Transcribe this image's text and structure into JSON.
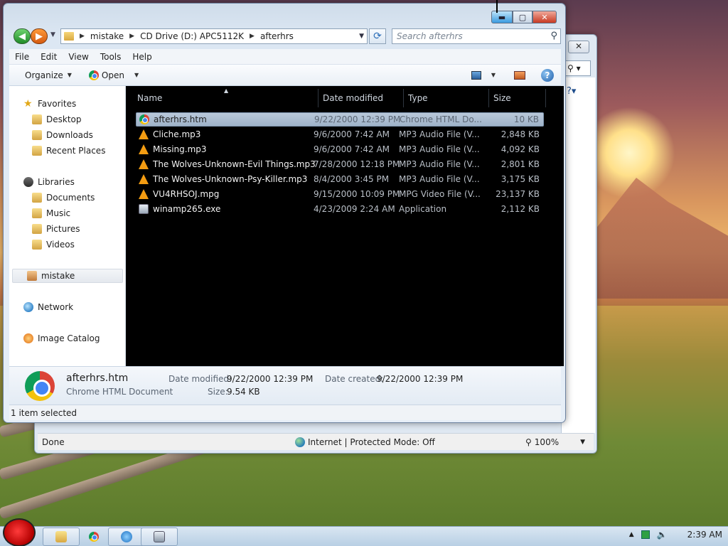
{
  "explorer": {
    "breadcrumb": [
      "mistake",
      "CD Drive (D:) APC5112K",
      "afterhrs"
    ],
    "search_placeholder": "Search afterhrs",
    "menu": [
      "File",
      "Edit",
      "View",
      "Tools",
      "Help"
    ],
    "toolbar": {
      "organize": "Organize",
      "open": "Open"
    },
    "nav": {
      "favorites": "Favorites",
      "desktop": "Desktop",
      "downloads": "Downloads",
      "recent": "Recent Places",
      "libraries": "Libraries",
      "documents": "Documents",
      "music": "Music",
      "pictures": "Pictures",
      "videos": "Videos",
      "user": "mistake",
      "network": "Network",
      "catalog": "Image Catalog"
    },
    "columns": {
      "name": "Name",
      "date": "Date modified",
      "type": "Type",
      "size": "Size"
    },
    "files": [
      {
        "name": "afterhrs.htm",
        "date": "9/22/2000 12:39 PM",
        "type": "Chrome HTML Do...",
        "size": "10 KB"
      },
      {
        "name": "Cliche.mp3",
        "date": "9/6/2000 7:42 AM",
        "type": "MP3 Audio File (V...",
        "size": "2,848 KB"
      },
      {
        "name": "Missing.mp3",
        "date": "9/6/2000 7:42 AM",
        "type": "MP3 Audio File (V...",
        "size": "4,092 KB"
      },
      {
        "name": "The Wolves-Unknown-Evil Things.mp3",
        "date": "7/28/2000 12:18 PM",
        "type": "MP3 Audio File (V...",
        "size": "2,801 KB"
      },
      {
        "name": "The Wolves-Unknown-Psy-Killer.mp3",
        "date": "8/4/2000 3:45 PM",
        "type": "MP3 Audio File (V...",
        "size": "3,175 KB"
      },
      {
        "name": "VU4RHSOJ.mpg",
        "date": "9/15/2000 10:09 PM",
        "type": "MPG Video File (V...",
        "size": "23,137 KB"
      },
      {
        "name": "winamp265.exe",
        "date": "4/23/2009 2:24 AM",
        "type": "Application",
        "size": "2,112 KB"
      }
    ],
    "details": {
      "name": "afterhrs.htm",
      "kind": "Chrome HTML Document",
      "modified_label": "Date modified:",
      "modified": "9/22/2000 12:39 PM",
      "created_label": "Date created:",
      "created": "9/22/2000 12:39 PM",
      "size_label": "Size:",
      "size": "9.54 KB"
    },
    "status": "1 item selected"
  },
  "ie": {
    "status_done": "Done",
    "zone": "Internet | Protected Mode: Off",
    "zoom": "100%"
  },
  "taskbar": {
    "clock": "2:39 AM"
  }
}
